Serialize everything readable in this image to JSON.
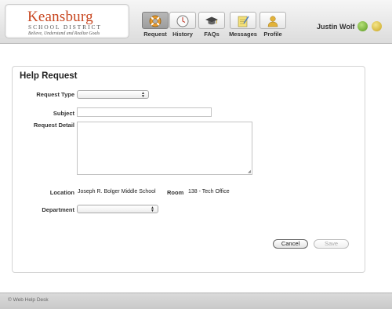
{
  "colors": {
    "brand": "#c8461f",
    "header_bg": "#e4e4e4",
    "active_tab": "#a8a8a8"
  },
  "logo": {
    "name": "Keansburg",
    "subtitle": "SCHOOL DISTRICT",
    "tagline": "Believe, Understand and Realize Goals"
  },
  "nav": [
    {
      "label": "Request",
      "icon": "life-ring-icon",
      "active": true
    },
    {
      "label": "History",
      "icon": "clock-icon",
      "active": false
    },
    {
      "label": "FAQs",
      "icon": "graduation-cap-icon",
      "active": false
    },
    {
      "label": "Messages",
      "icon": "notepad-icon",
      "active": false
    },
    {
      "label": "Profile",
      "icon": "person-icon",
      "active": false
    }
  ],
  "user": {
    "name": "Justin Wolf",
    "icons": [
      "status-icon",
      "logout-icon"
    ]
  },
  "form": {
    "title": "Help Request",
    "request_type_label": "Request Type",
    "request_type_value": "",
    "subject_label": "Subject",
    "subject_value": "",
    "detail_label": "Request Detail",
    "detail_value": "",
    "location_label": "Location",
    "location_value": "Joseph R. Bolger Middle School",
    "room_label": "Room",
    "room_value": "138 - Tech Office",
    "department_label": "Department",
    "department_value": "",
    "cancel_label": "Cancel",
    "save_label": "Save"
  },
  "footer": {
    "text": "© Web Help Desk"
  }
}
